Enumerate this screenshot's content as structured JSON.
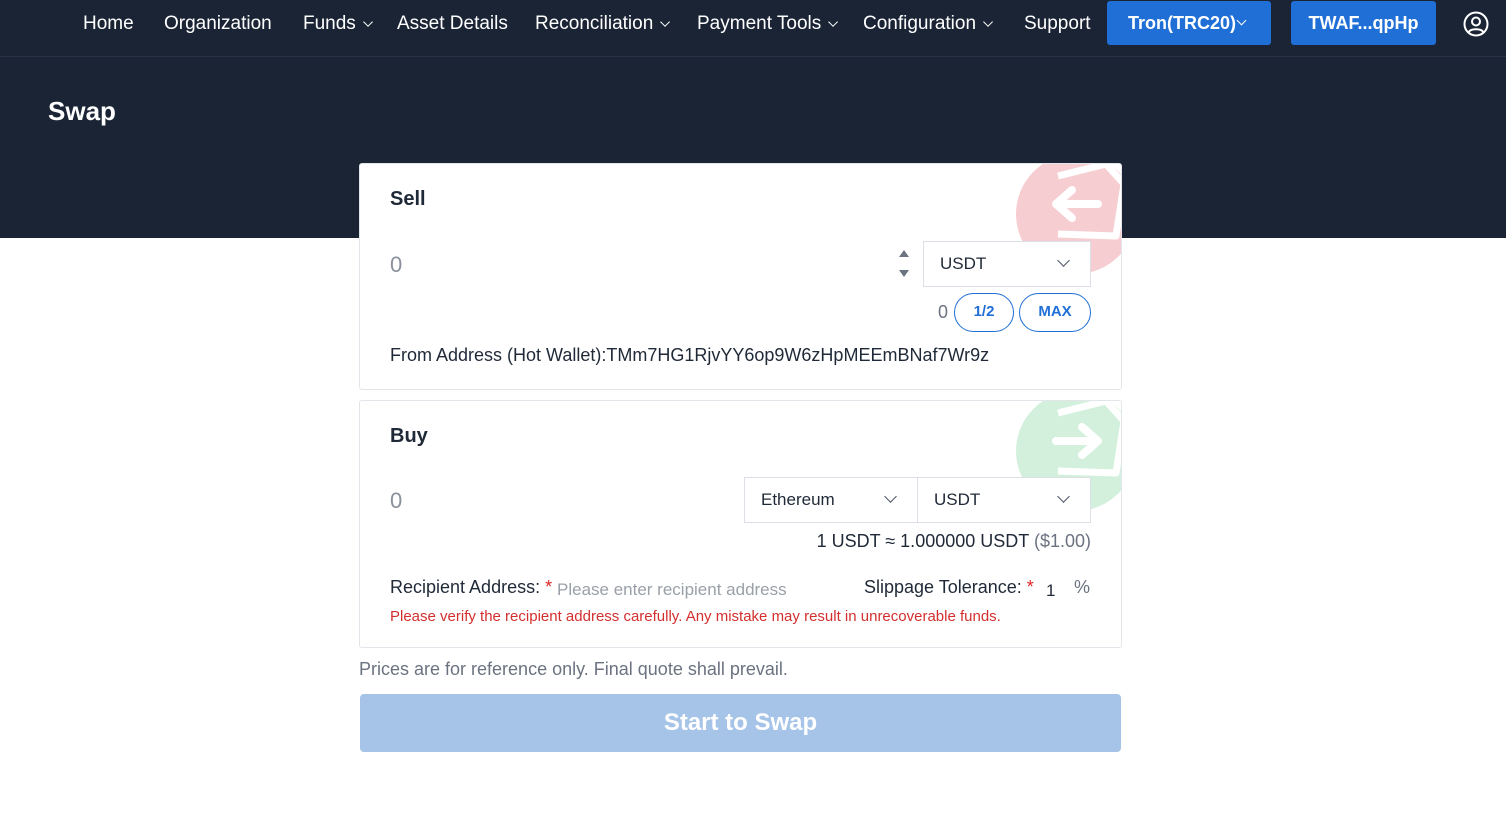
{
  "nav": {
    "items": [
      {
        "label": "Home"
      },
      {
        "label": "Organization"
      },
      {
        "label": "Funds"
      },
      {
        "label": "Asset Details"
      },
      {
        "label": "Reconciliation"
      },
      {
        "label": "Payment Tools"
      },
      {
        "label": "Configuration"
      },
      {
        "label": "Support"
      }
    ],
    "network_label": "Tron(TRC20)",
    "wallet_label": "TWAF...qpHp",
    "user_icon": "user-circle-icon"
  },
  "page": {
    "title": "Swap"
  },
  "sell": {
    "title": "Sell",
    "amount": "0",
    "token": "USDT",
    "balance": "0",
    "half_label": "1/2",
    "max_label": "MAX",
    "from_address": "From Address (Hot Wallet):TMm7HG1RjvYY6op9W6zHpMEEmBNaf7Wr9z",
    "deco_icon": "arrow-left-icon",
    "deco_color": "#f6cdd0"
  },
  "buy": {
    "title": "Buy",
    "amount": "0",
    "network": "Ethereum",
    "token": "USDT",
    "rate_main": "1 USDT ≈ 1.000000 USDT",
    "rate_usd": "($1.00)",
    "recipient_label": "Recipient Address:",
    "recipient_placeholder": "Please enter recipient address",
    "slippage_label": "Slippage Tolerance:",
    "slippage_value": "1",
    "slippage_unit": "%",
    "required_mark": "*",
    "warning": "Please verify the recipient address carefully. Any mistake may result in unrecoverable funds.",
    "deco_icon": "arrow-right-icon",
    "deco_color": "#d3f0dc"
  },
  "footer": {
    "note": "Prices are for reference only. Final quote shall prevail.",
    "swap_label": "Start to Swap"
  },
  "colors": {
    "header_bg": "#1a2435",
    "accent": "#1f6fd6",
    "swap_disabled": "#a6c3e8",
    "warning": "#d32f2f"
  }
}
